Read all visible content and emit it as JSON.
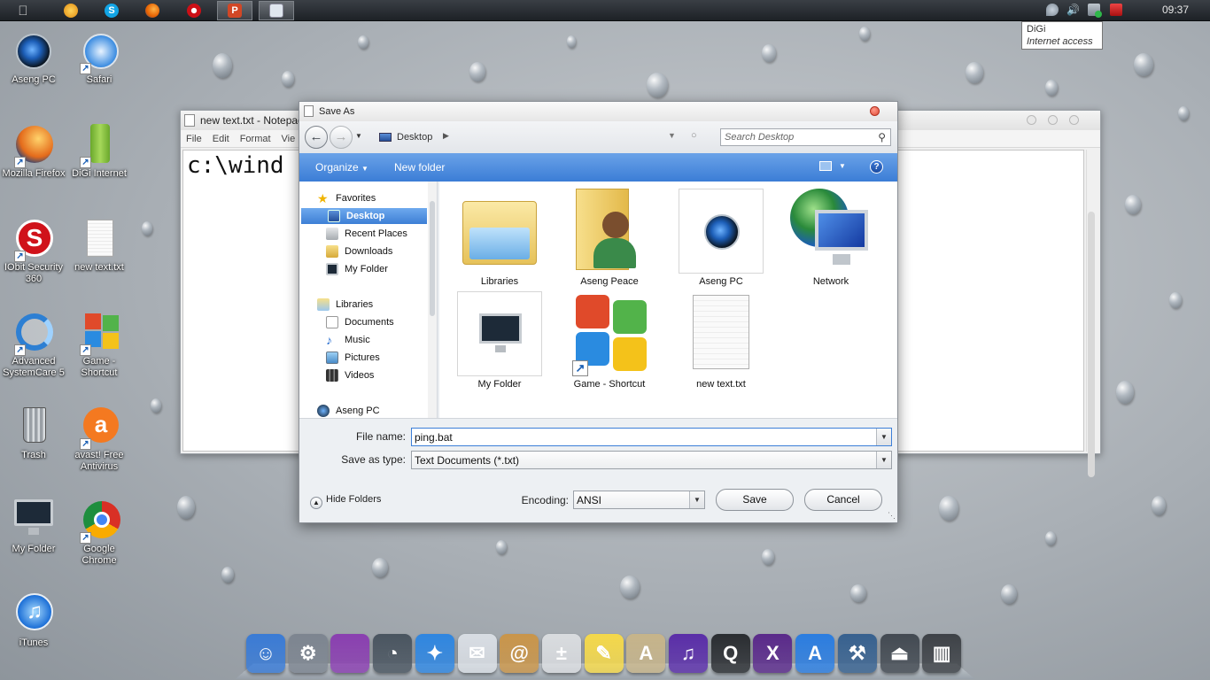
{
  "topbar": {
    "clock": "09:37",
    "apps": [
      {
        "name": "apple-menu-icon",
        "color": "#dcdcdc"
      },
      {
        "name": "weather-app-icon",
        "color": "#f5a623"
      },
      {
        "name": "skype-icon",
        "color": "#12a5e6"
      },
      {
        "name": "firefox-icon",
        "color": "#e66000"
      },
      {
        "name": "opera-icon",
        "color": "#cc0f16"
      },
      {
        "name": "powerpoint-icon",
        "color": "#d24726"
      },
      {
        "name": "notepad-icon",
        "color": "#dfe6ee"
      }
    ]
  },
  "tooltip": {
    "line1": "DiGi",
    "line2": "Internet access"
  },
  "desktop": {
    "icons": [
      {
        "label": "Aseng PC",
        "color": "#2b3a4a"
      },
      {
        "label": "Safari",
        "color": "#3a8be0"
      },
      {
        "label": "Mozilla Firefox",
        "color": "#e46b1b"
      },
      {
        "label": "DiGi Internet",
        "color": "#8bc53f"
      },
      {
        "label": "IObit Security 360",
        "color": "#d0121a"
      },
      {
        "label": "new text.txt",
        "color": "#f2f2f2"
      },
      {
        "label": "Advanced SystemCare 5",
        "color": "#2d7fd3"
      },
      {
        "label": "Game - Shortcut",
        "color": "#e8a020"
      },
      {
        "label": "Trash",
        "color": "#7a7a7a"
      },
      {
        "label": "avast! Free Antivirus",
        "color": "#f47920"
      },
      {
        "label": "My Folder",
        "color": "#1d2a38"
      },
      {
        "label": "Google Chrome",
        "color": "#d93025"
      },
      {
        "label": "iTunes",
        "color": "#1b6ed6"
      }
    ]
  },
  "notepad": {
    "title": "new text.txt - Notepad",
    "menu": [
      "File",
      "Edit",
      "Format",
      "Vie"
    ],
    "content": "c:\\wind"
  },
  "dialog": {
    "title": "Save As",
    "address": "Desktop",
    "search_placeholder": "Search Desktop",
    "organize": "Organize",
    "new_folder": "New folder",
    "nav": {
      "favorites": "Favorites",
      "desktop": "Desktop",
      "recent": "Recent Places",
      "downloads": "Downloads",
      "myfolder": "My Folder",
      "libraries": "Libraries",
      "documents": "Documents",
      "music": "Music",
      "pictures": "Pictures",
      "videos": "Videos",
      "asengpc": "Aseng PC"
    },
    "files": [
      {
        "label": "Libraries"
      },
      {
        "label": "Aseng Peace"
      },
      {
        "label": "Aseng PC"
      },
      {
        "label": "Network"
      },
      {
        "label": "My Folder"
      },
      {
        "label": "Game - Shortcut"
      },
      {
        "label": "new text.txt"
      }
    ],
    "file_name_label": "File name:",
    "file_name_value": "ping.bat",
    "save_type_label": "Save as type:",
    "save_type_value": "Text Documents (*.txt)",
    "encoding_label": "Encoding:",
    "encoding_value": "ANSI",
    "save": "Save",
    "cancel": "Cancel",
    "hide_folders": "Hide Folders"
  },
  "dock": {
    "items": [
      {
        "name": "finder-icon",
        "color": "#3a7bd5",
        "glyph": "☺"
      },
      {
        "name": "system-preferences-icon",
        "color": "#7d8590",
        "glyph": "⚙"
      },
      {
        "name": "wallpaper-icon",
        "color": "#8a3fb0",
        "glyph": ""
      },
      {
        "name": "dashboard-icon",
        "color": "#4a5560",
        "glyph": "◔"
      },
      {
        "name": "safari-dock-icon",
        "color": "#2f86e0",
        "glyph": "✦"
      },
      {
        "name": "mail-icon",
        "color": "#d8dde3",
        "glyph": "✉"
      },
      {
        "name": "address-book-icon",
        "color": "#c9954a",
        "glyph": "@"
      },
      {
        "name": "calculator-icon",
        "color": "#d9dcdf",
        "glyph": "±"
      },
      {
        "name": "stickies-icon",
        "color": "#f4d84a",
        "glyph": "✎"
      },
      {
        "name": "text-editor-icon",
        "color": "#c6b48a",
        "glyph": "A"
      },
      {
        "name": "itunes-dock-icon",
        "color": "#5a2ea8",
        "glyph": "♫"
      },
      {
        "name": "quicktime-icon",
        "color": "#2a2d31",
        "glyph": "Q"
      },
      {
        "name": "x11-icon",
        "color": "#5a2a8a",
        "glyph": "X"
      },
      {
        "name": "app-store-icon",
        "color": "#2b7de0",
        "glyph": "A"
      },
      {
        "name": "xcode-icon",
        "color": "#37618f",
        "glyph": "⚒"
      },
      {
        "name": "eject-icon",
        "color": "#434a52",
        "glyph": "⏏"
      },
      {
        "name": "trash-dock-icon",
        "color": "#3e4247",
        "glyph": "▥"
      }
    ]
  }
}
